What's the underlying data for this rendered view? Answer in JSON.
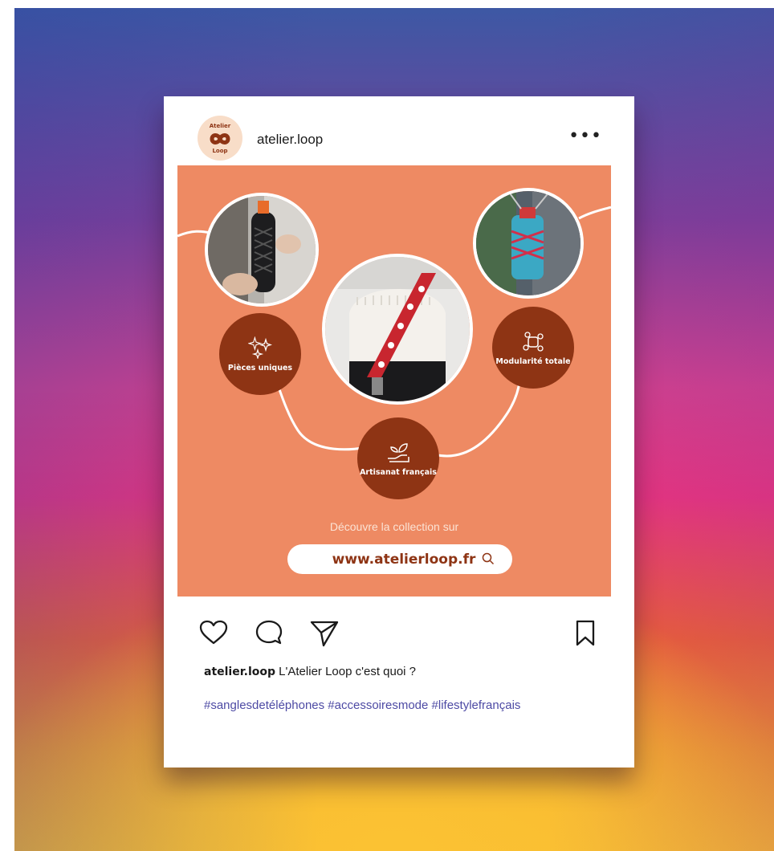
{
  "post": {
    "username": "atelier.loop",
    "avatar_text_top": "Atelier",
    "avatar_text_bottom": "Loop",
    "more_icon": "•••",
    "features": [
      {
        "label": "Pièces uniques",
        "icon": "sparkles-icon"
      },
      {
        "label": "Artisanat français",
        "icon": "hand-plant-icon"
      },
      {
        "label": "Modularité totale",
        "icon": "modules-icon"
      }
    ],
    "cta_text": "Découvre la collection sur",
    "url": "www.atelierloop.fr",
    "colors": {
      "post_bg": "#ee8a63",
      "feature_bg": "#8e3414",
      "hashtag": "#4d4aa4"
    }
  },
  "caption": {
    "username": "atelier.loop",
    "text": " L'Atelier Loop c'est quoi ?",
    "hashtags": "#sanglesdetéléphones #accessoiresmode #lifestylefrançais"
  },
  "actions": [
    "heart-icon",
    "comment-icon",
    "share-icon",
    "bookmark-icon"
  ]
}
